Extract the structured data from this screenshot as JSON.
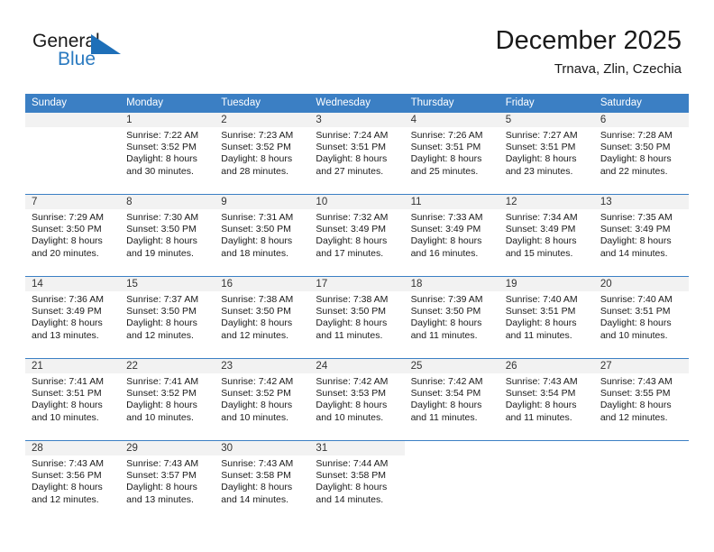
{
  "brand": {
    "name_part1": "General",
    "name_part2": "Blue",
    "logo_color": "#2a7ac0",
    "triangle_icon": "triangle-icon"
  },
  "header": {
    "title": "December 2025",
    "subtitle": "Trnava, Zlin, Czechia"
  },
  "theme": {
    "header_blue": "#3b7fc4",
    "band_gray": "#f2f2f2",
    "text_dark": "#1a1a1a"
  },
  "weekday_headers": [
    "Sunday",
    "Monday",
    "Tuesday",
    "Wednesday",
    "Thursday",
    "Friday",
    "Saturday"
  ],
  "weeks": [
    [
      {
        "day": "",
        "sunrise": "",
        "sunset": "",
        "daylight_line1": "",
        "daylight_line2": "",
        "state": "empty"
      },
      {
        "day": "1",
        "sunrise": "Sunrise: 7:22 AM",
        "sunset": "Sunset: 3:52 PM",
        "daylight_line1": "Daylight: 8 hours",
        "daylight_line2": "and 30 minutes.",
        "state": "filled"
      },
      {
        "day": "2",
        "sunrise": "Sunrise: 7:23 AM",
        "sunset": "Sunset: 3:52 PM",
        "daylight_line1": "Daylight: 8 hours",
        "daylight_line2": "and 28 minutes.",
        "state": "filled"
      },
      {
        "day": "3",
        "sunrise": "Sunrise: 7:24 AM",
        "sunset": "Sunset: 3:51 PM",
        "daylight_line1": "Daylight: 8 hours",
        "daylight_line2": "and 27 minutes.",
        "state": "filled"
      },
      {
        "day": "4",
        "sunrise": "Sunrise: 7:26 AM",
        "sunset": "Sunset: 3:51 PM",
        "daylight_line1": "Daylight: 8 hours",
        "daylight_line2": "and 25 minutes.",
        "state": "filled"
      },
      {
        "day": "5",
        "sunrise": "Sunrise: 7:27 AM",
        "sunset": "Sunset: 3:51 PM",
        "daylight_line1": "Daylight: 8 hours",
        "daylight_line2": "and 23 minutes.",
        "state": "filled"
      },
      {
        "day": "6",
        "sunrise": "Sunrise: 7:28 AM",
        "sunset": "Sunset: 3:50 PM",
        "daylight_line1": "Daylight: 8 hours",
        "daylight_line2": "and 22 minutes.",
        "state": "filled"
      }
    ],
    [
      {
        "day": "7",
        "sunrise": "Sunrise: 7:29 AM",
        "sunset": "Sunset: 3:50 PM",
        "daylight_line1": "Daylight: 8 hours",
        "daylight_line2": "and 20 minutes.",
        "state": "filled"
      },
      {
        "day": "8",
        "sunrise": "Sunrise: 7:30 AM",
        "sunset": "Sunset: 3:50 PM",
        "daylight_line1": "Daylight: 8 hours",
        "daylight_line2": "and 19 minutes.",
        "state": "filled"
      },
      {
        "day": "9",
        "sunrise": "Sunrise: 7:31 AM",
        "sunset": "Sunset: 3:50 PM",
        "daylight_line1": "Daylight: 8 hours",
        "daylight_line2": "and 18 minutes.",
        "state": "filled"
      },
      {
        "day": "10",
        "sunrise": "Sunrise: 7:32 AM",
        "sunset": "Sunset: 3:49 PM",
        "daylight_line1": "Daylight: 8 hours",
        "daylight_line2": "and 17 minutes.",
        "state": "filled"
      },
      {
        "day": "11",
        "sunrise": "Sunrise: 7:33 AM",
        "sunset": "Sunset: 3:49 PM",
        "daylight_line1": "Daylight: 8 hours",
        "daylight_line2": "and 16 minutes.",
        "state": "filled"
      },
      {
        "day": "12",
        "sunrise": "Sunrise: 7:34 AM",
        "sunset": "Sunset: 3:49 PM",
        "daylight_line1": "Daylight: 8 hours",
        "daylight_line2": "and 15 minutes.",
        "state": "filled"
      },
      {
        "day": "13",
        "sunrise": "Sunrise: 7:35 AM",
        "sunset": "Sunset: 3:49 PM",
        "daylight_line1": "Daylight: 8 hours",
        "daylight_line2": "and 14 minutes.",
        "state": "filled"
      }
    ],
    [
      {
        "day": "14",
        "sunrise": "Sunrise: 7:36 AM",
        "sunset": "Sunset: 3:49 PM",
        "daylight_line1": "Daylight: 8 hours",
        "daylight_line2": "and 13 minutes.",
        "state": "filled"
      },
      {
        "day": "15",
        "sunrise": "Sunrise: 7:37 AM",
        "sunset": "Sunset: 3:50 PM",
        "daylight_line1": "Daylight: 8 hours",
        "daylight_line2": "and 12 minutes.",
        "state": "filled"
      },
      {
        "day": "16",
        "sunrise": "Sunrise: 7:38 AM",
        "sunset": "Sunset: 3:50 PM",
        "daylight_line1": "Daylight: 8 hours",
        "daylight_line2": "and 12 minutes.",
        "state": "filled"
      },
      {
        "day": "17",
        "sunrise": "Sunrise: 7:38 AM",
        "sunset": "Sunset: 3:50 PM",
        "daylight_line1": "Daylight: 8 hours",
        "daylight_line2": "and 11 minutes.",
        "state": "filled"
      },
      {
        "day": "18",
        "sunrise": "Sunrise: 7:39 AM",
        "sunset": "Sunset: 3:50 PM",
        "daylight_line1": "Daylight: 8 hours",
        "daylight_line2": "and 11 minutes.",
        "state": "filled"
      },
      {
        "day": "19",
        "sunrise": "Sunrise: 7:40 AM",
        "sunset": "Sunset: 3:51 PM",
        "daylight_line1": "Daylight: 8 hours",
        "daylight_line2": "and 11 minutes.",
        "state": "filled"
      },
      {
        "day": "20",
        "sunrise": "Sunrise: 7:40 AM",
        "sunset": "Sunset: 3:51 PM",
        "daylight_line1": "Daylight: 8 hours",
        "daylight_line2": "and 10 minutes.",
        "state": "filled"
      }
    ],
    [
      {
        "day": "21",
        "sunrise": "Sunrise: 7:41 AM",
        "sunset": "Sunset: 3:51 PM",
        "daylight_line1": "Daylight: 8 hours",
        "daylight_line2": "and 10 minutes.",
        "state": "filled"
      },
      {
        "day": "22",
        "sunrise": "Sunrise: 7:41 AM",
        "sunset": "Sunset: 3:52 PM",
        "daylight_line1": "Daylight: 8 hours",
        "daylight_line2": "and 10 minutes.",
        "state": "filled"
      },
      {
        "day": "23",
        "sunrise": "Sunrise: 7:42 AM",
        "sunset": "Sunset: 3:52 PM",
        "daylight_line1": "Daylight: 8 hours",
        "daylight_line2": "and 10 minutes.",
        "state": "filled"
      },
      {
        "day": "24",
        "sunrise": "Sunrise: 7:42 AM",
        "sunset": "Sunset: 3:53 PM",
        "daylight_line1": "Daylight: 8 hours",
        "daylight_line2": "and 10 minutes.",
        "state": "filled"
      },
      {
        "day": "25",
        "sunrise": "Sunrise: 7:42 AM",
        "sunset": "Sunset: 3:54 PM",
        "daylight_line1": "Daylight: 8 hours",
        "daylight_line2": "and 11 minutes.",
        "state": "filled"
      },
      {
        "day": "26",
        "sunrise": "Sunrise: 7:43 AM",
        "sunset": "Sunset: 3:54 PM",
        "daylight_line1": "Daylight: 8 hours",
        "daylight_line2": "and 11 minutes.",
        "state": "filled"
      },
      {
        "day": "27",
        "sunrise": "Sunrise: 7:43 AM",
        "sunset": "Sunset: 3:55 PM",
        "daylight_line1": "Daylight: 8 hours",
        "daylight_line2": "and 12 minutes.",
        "state": "filled"
      }
    ],
    [
      {
        "day": "28",
        "sunrise": "Sunrise: 7:43 AM",
        "sunset": "Sunset: 3:56 PM",
        "daylight_line1": "Daylight: 8 hours",
        "daylight_line2": "and 12 minutes.",
        "state": "filled"
      },
      {
        "day": "29",
        "sunrise": "Sunrise: 7:43 AM",
        "sunset": "Sunset: 3:57 PM",
        "daylight_line1": "Daylight: 8 hours",
        "daylight_line2": "and 13 minutes.",
        "state": "filled"
      },
      {
        "day": "30",
        "sunrise": "Sunrise: 7:43 AM",
        "sunset": "Sunset: 3:58 PM",
        "daylight_line1": "Daylight: 8 hours",
        "daylight_line2": "and 14 minutes.",
        "state": "filled"
      },
      {
        "day": "31",
        "sunrise": "Sunrise: 7:44 AM",
        "sunset": "Sunset: 3:58 PM",
        "daylight_line1": "Daylight: 8 hours",
        "daylight_line2": "and 14 minutes.",
        "state": "filled"
      },
      {
        "day": "",
        "sunrise": "",
        "sunset": "",
        "daylight_line1": "",
        "daylight_line2": "",
        "state": "blank"
      },
      {
        "day": "",
        "sunrise": "",
        "sunset": "",
        "daylight_line1": "",
        "daylight_line2": "",
        "state": "blank"
      },
      {
        "day": "",
        "sunrise": "",
        "sunset": "",
        "daylight_line1": "",
        "daylight_line2": "",
        "state": "blank"
      }
    ]
  ]
}
